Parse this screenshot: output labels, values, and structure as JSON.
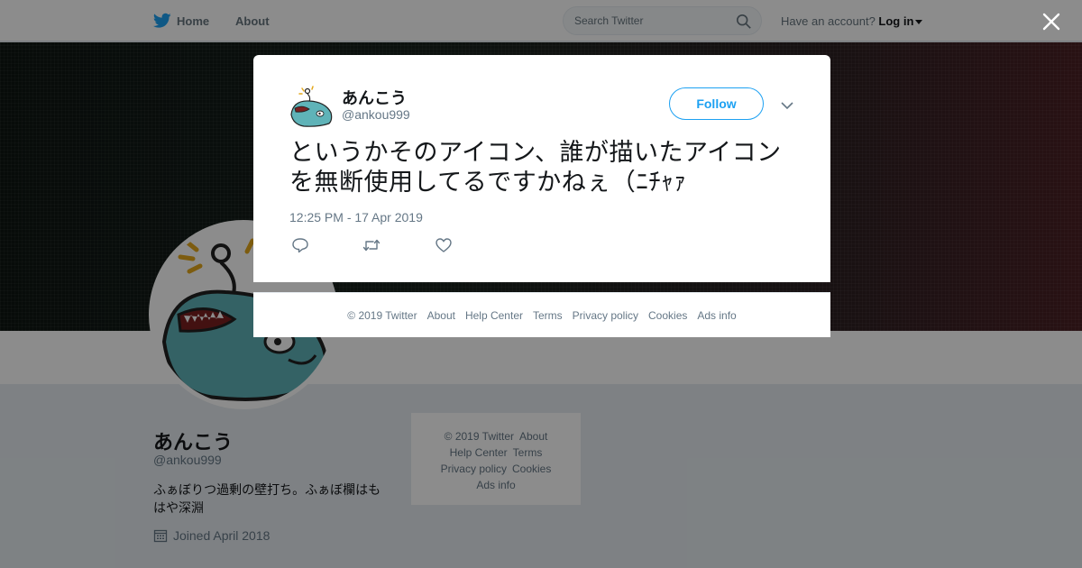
{
  "topbar": {
    "home_label": "Home",
    "about_label": "About",
    "search_placeholder": "Search Twitter",
    "account_prompt": "Have an account?",
    "login_label": "Log in"
  },
  "profile": {
    "name": "あんこう",
    "handle": "@ankou999",
    "bio": "ふぁぼりつ過剰の壁打ち。ふぁぼ欄はもはや深淵",
    "joined": "Joined April 2018"
  },
  "side_footer": {
    "line1": [
      "© 2019 Twitter",
      "About"
    ],
    "line2": [
      "Help Center",
      "Terms"
    ],
    "line3": [
      "Privacy policy",
      "Cookies"
    ],
    "line4": [
      "Ads info"
    ]
  },
  "tweet": {
    "author_name": "あんこう",
    "author_handle": "@ankou999",
    "follow_label": "Follow",
    "text": "というかそのアイコン、誰が描いたアイコンを無断使用してるですかねぇ（ﾆﾁｬｧ",
    "timestamp": "12:25 PM - 17 Apr 2019"
  },
  "modal_footer": {
    "copyright": "© 2019 Twitter",
    "about": "About",
    "help": "Help Center",
    "terms": "Terms",
    "privacy": "Privacy policy",
    "cookies": "Cookies",
    "ads": "Ads info"
  },
  "colors": {
    "accent": "#1da1f2",
    "secondary_text": "#657786",
    "avatar_fish": "#5fb3b8"
  }
}
